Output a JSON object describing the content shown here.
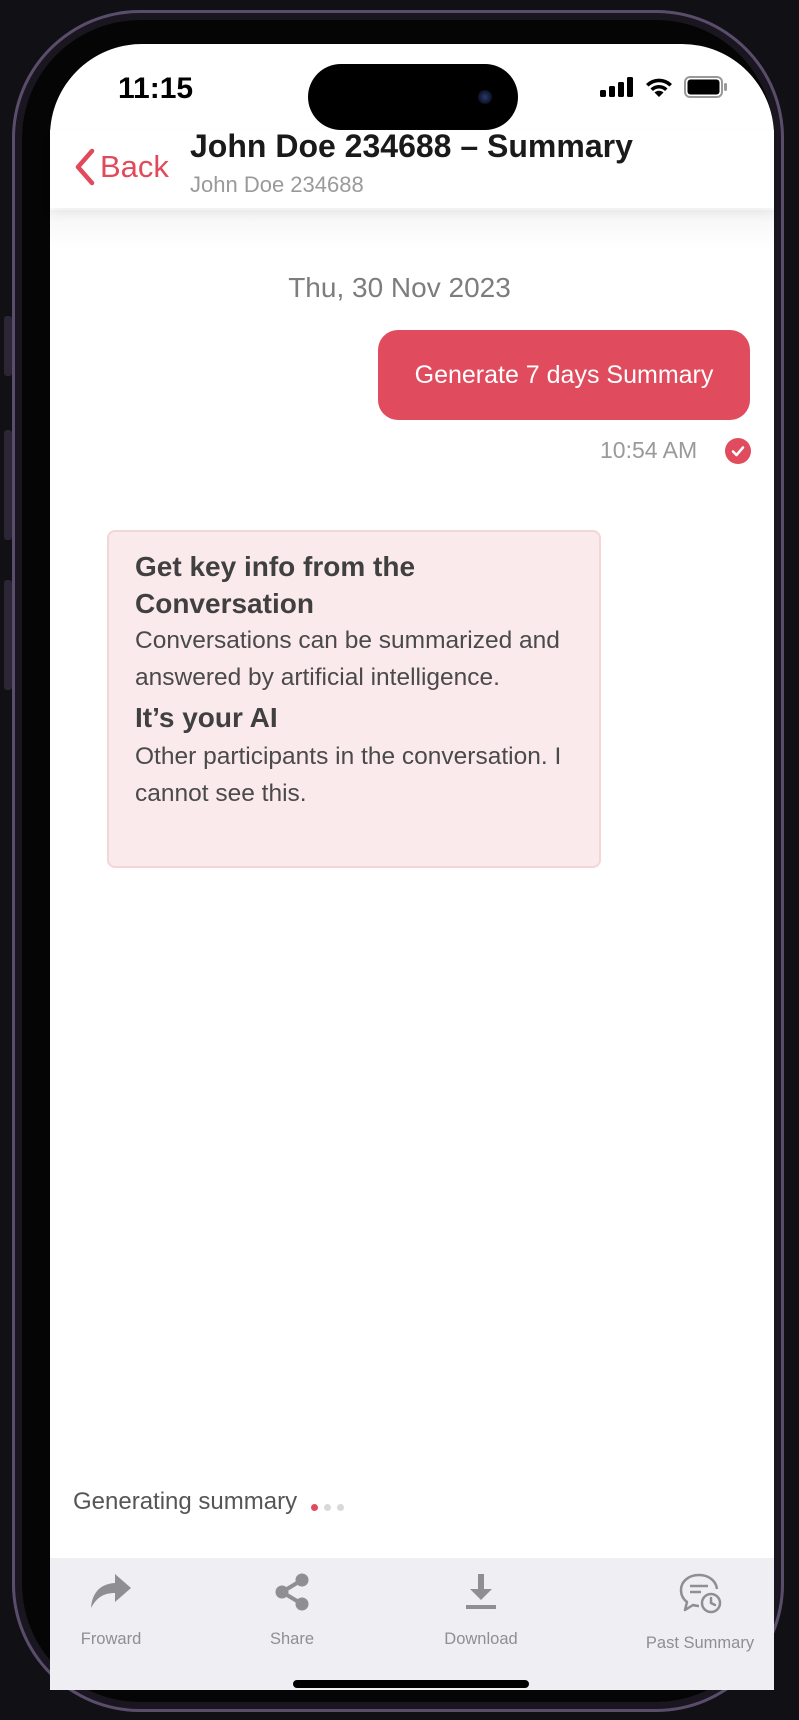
{
  "status_bar": {
    "time": "11:15"
  },
  "header": {
    "back_label": "Back",
    "title": "John Doe 234688 – Summary",
    "subtitle": "John Doe 234688"
  },
  "chat": {
    "date": "Thu, 30 Nov 2023",
    "message": {
      "text": "Generate 7 days Summary",
      "time": "10:54 AM"
    },
    "info_card": {
      "heading": "Get key info from the Conversation",
      "body": "Conversations can be summarized and answered by artificial intelligence.",
      "heading2": "It’s your AI",
      "body2": "Other participants in the conversation. I cannot see this."
    },
    "generating_label": "Generating summary"
  },
  "tabbar": {
    "items": [
      {
        "label": "Froward",
        "icon": "forward-icon"
      },
      {
        "label": "Share",
        "icon": "share-icon"
      },
      {
        "label": "Download",
        "icon": "download-icon"
      },
      {
        "label": "Past Summary",
        "icon": "past-summary-icon"
      }
    ]
  },
  "colors": {
    "accent": "#e04c5e",
    "card_bg": "#fbeaeb",
    "tabbar_bg": "#efeff3"
  }
}
